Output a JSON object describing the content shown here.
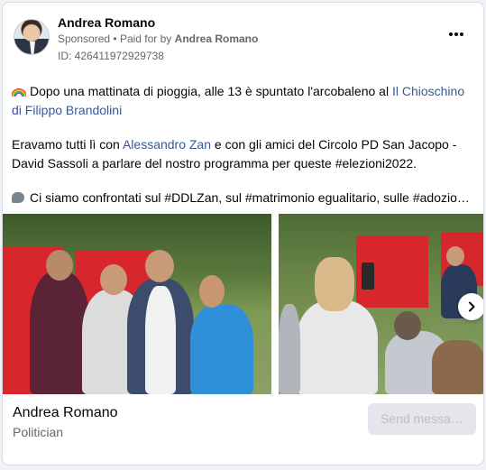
{
  "post": {
    "author": "Andrea Romano",
    "sponsored_label": "Sponsored",
    "paid_prefix": "Paid for by",
    "paid_by": "Andrea Romano",
    "ad_id": "ID: 426411972929738",
    "more_icon": "more-horizontal-icon"
  },
  "body": {
    "p1_text": "Dopo una mattinata di pioggia, alle 13 è spuntato l'arcobaleno al ",
    "p1_link": "Il Chioschino di Filippo Brandolini",
    "p2_a": "Eravamo tutti lì con ",
    "p2_link": "Alessandro Zan",
    "p2_b": " e con gli amici del Circolo PD San Jacopo - David Sassoli a parlare del nostro programma per queste #elezioni2022.",
    "p3": "Ci siamo confrontati sul #DDLZan, sul #matrimonio egualitario, sulle #adozio…"
  },
  "colors": {
    "link": "#385898",
    "secondary_text": "#65676b",
    "banner_red": "#d8262d"
  },
  "footer": {
    "page_name": "Andrea Romano",
    "page_category": "Politician",
    "send_button": "Send messa…"
  }
}
